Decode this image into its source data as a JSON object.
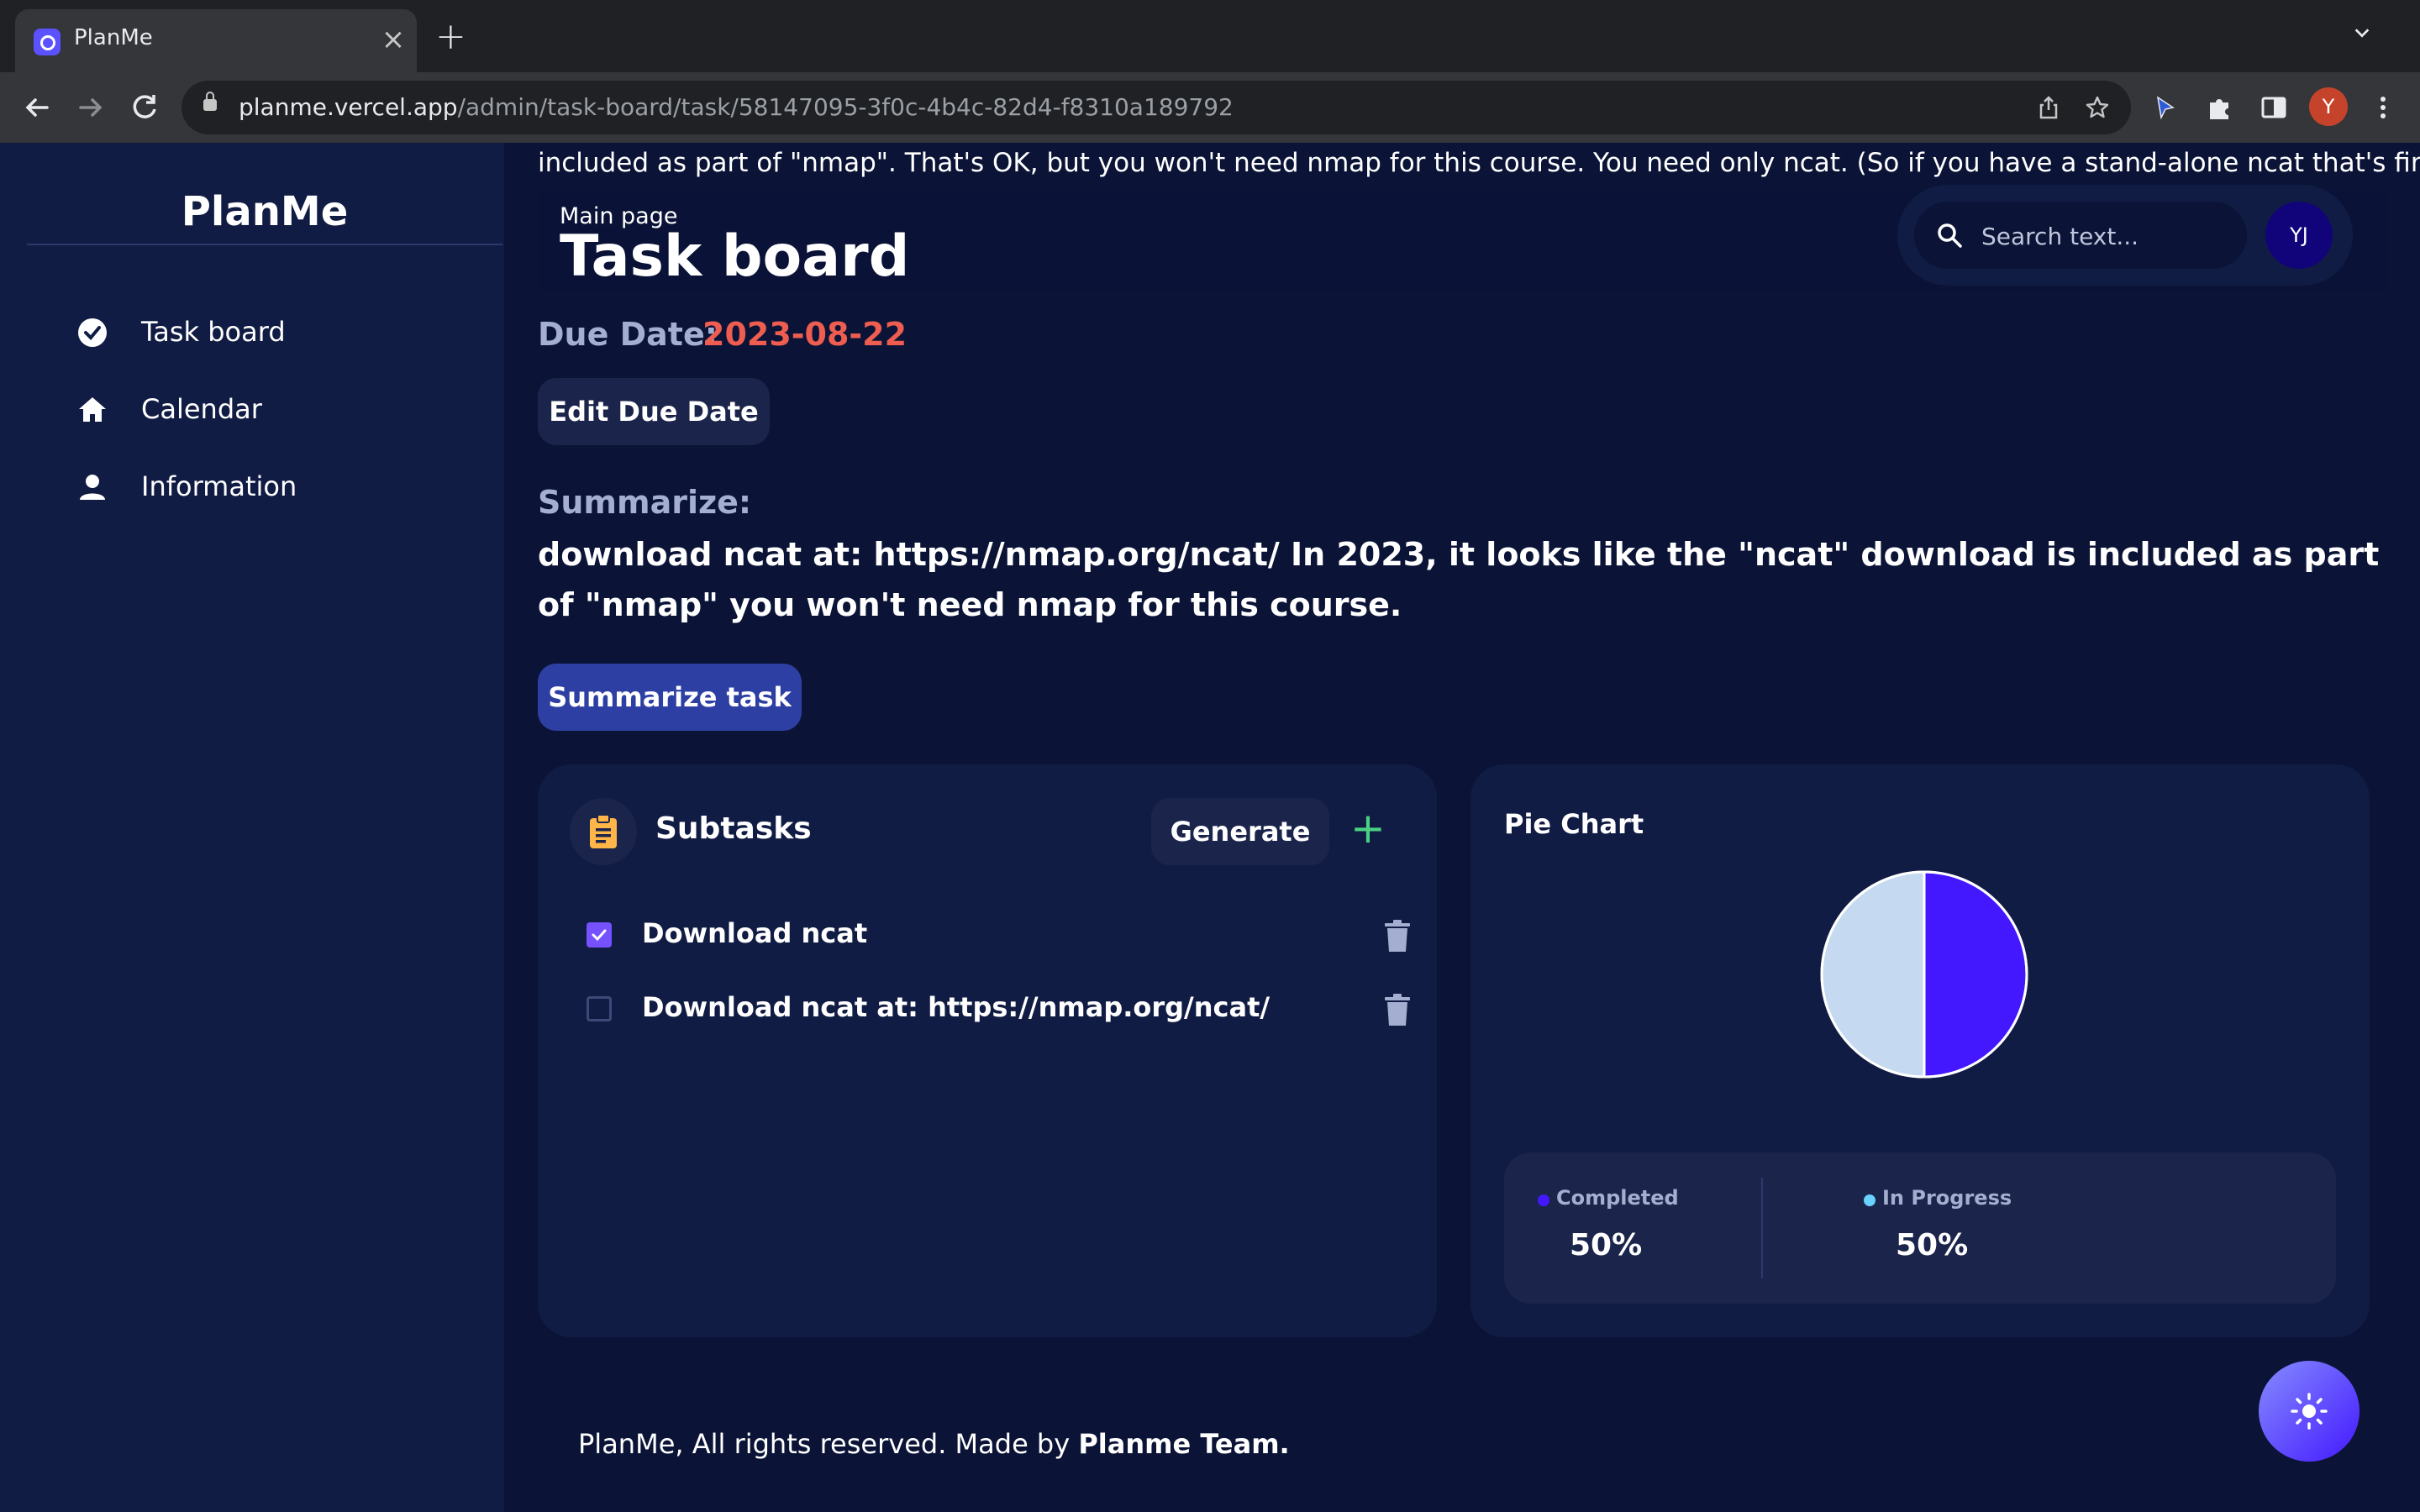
{
  "browser": {
    "tab_title": "PlanMe",
    "url_host": "planme.vercel.app",
    "url_path": "/admin/task-board/task/58147095-3f0c-4b4c-82d4-f8310a189792",
    "profile_initial": "Y"
  },
  "sidebar": {
    "brand": "PlanMe",
    "items": [
      {
        "label": "Task board",
        "icon": "check-circle-icon"
      },
      {
        "label": "Calendar",
        "icon": "home-icon"
      },
      {
        "label": "Information",
        "icon": "person-icon"
      }
    ]
  },
  "header": {
    "overflow_text": "included as part of \"nmap\". That's OK, but you won't need nmap for this course. You need only ncat. (So if you have a stand-alone ncat that's fine.)",
    "breadcrumb": "Main page",
    "title": "Task board",
    "search_placeholder": "Search text...",
    "avatar_initials": "YJ"
  },
  "task": {
    "due_label": "Due Date:",
    "due_value": "2023-08-22",
    "edit_due_label": "Edit Due Date",
    "summary_label": "Summarize:",
    "summary_text": "download ncat at: https://nmap.org/ncat/ In 2023, it looks like the \"ncat\" download is included as part of \"nmap\" you won't need nmap for this course.",
    "summarize_button": "Summarize task"
  },
  "subtasks": {
    "title": "Subtasks",
    "generate_label": "Generate",
    "add_symbol": "+",
    "items": [
      {
        "text": "Download ncat",
        "checked": true
      },
      {
        "text": "Download ncat at: https://nmap.org/ncat/",
        "checked": false
      }
    ]
  },
  "chart_data": {
    "type": "pie",
    "title": "Pie Chart",
    "categories": [
      "Completed",
      "In Progress"
    ],
    "values": [
      50,
      50
    ],
    "colors": [
      "#4318ff",
      "#c5daf0"
    ],
    "legend_dot_colors": [
      "#4318ff",
      "#6ad2ff"
    ],
    "labels": [
      "50%",
      "50%"
    ]
  },
  "footer": {
    "text": "PlanMe, All rights reserved. Made by ",
    "team": "Planme Team."
  },
  "colors": {
    "background": "#0b1437",
    "card": "#111c44",
    "accent": "#4318ff",
    "due_date": "#ee5d50",
    "label_muted": "#a3aed0",
    "add_green": "#4ad082"
  }
}
